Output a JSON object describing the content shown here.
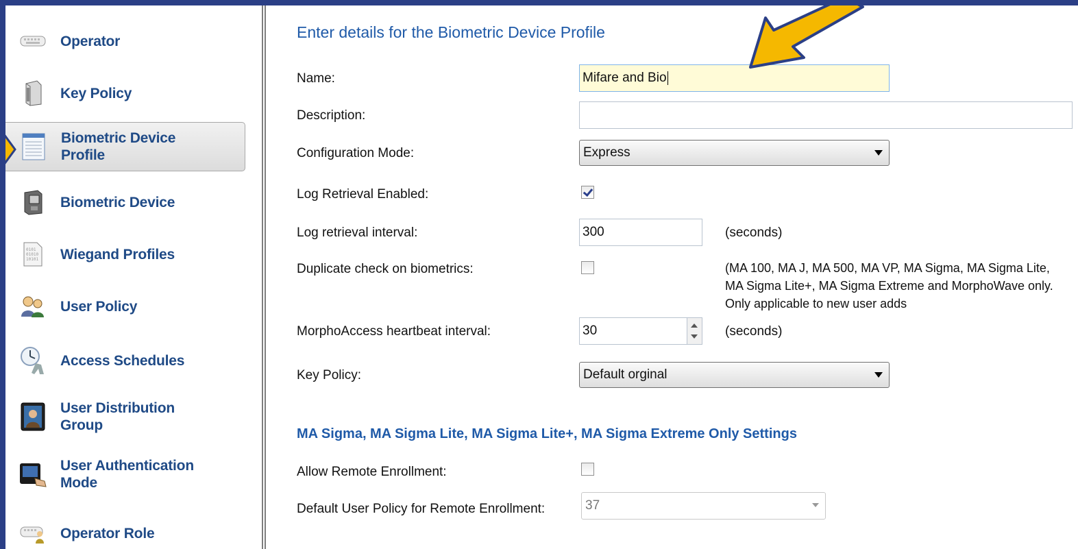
{
  "sidebar": {
    "items": [
      {
        "label": "Operator",
        "icon": "keyboard-icon"
      },
      {
        "label": "Key Policy",
        "icon": "server-icon"
      },
      {
        "label": "Biometric Device Profile",
        "icon": "document-list-icon"
      },
      {
        "label": "Biometric Device",
        "icon": "biometric-device-icon"
      },
      {
        "label": "Wiegand Profiles",
        "icon": "binary-document-icon"
      },
      {
        "label": "User Policy",
        "icon": "users-icon"
      },
      {
        "label": "Access Schedules",
        "icon": "clock-person-icon"
      },
      {
        "label": "User Distribution Group",
        "icon": "user-photo-icon"
      },
      {
        "label": "User Authentication Mode",
        "icon": "fingerprint-reader-icon"
      },
      {
        "label": "Operator Role",
        "icon": "keyboard-person-icon"
      }
    ],
    "selected_index": 2
  },
  "main": {
    "title": "Enter details for the Biometric Device Profile",
    "name": {
      "label": "Name:",
      "value": "Mifare and Bio"
    },
    "description": {
      "label": "Description:",
      "value": ""
    },
    "configuration_mode": {
      "label": "Configuration Mode:",
      "value": "Express"
    },
    "log_retrieval_enabled": {
      "label": "Log Retrieval Enabled:",
      "checked": true
    },
    "log_retrieval_interval": {
      "label": "Log retrieval interval:",
      "value": "300",
      "unit": "(seconds)"
    },
    "duplicate_check": {
      "label": "Duplicate check on biometrics:",
      "checked": false,
      "note": "(MA 100, MA J, MA 500, MA VP, MA Sigma, MA Sigma Lite, MA Sigma Lite+, MA Sigma Extreme and MorphoWave only.  Only applicable to new user adds"
    },
    "heartbeat_interval": {
      "label": "MorphoAccess heartbeat interval:",
      "value": "30",
      "unit": "(seconds)"
    },
    "key_policy": {
      "label": "Key Policy:",
      "value": "Default orginal"
    },
    "sigma_section_title": "MA Sigma, MA Sigma Lite, MA Sigma Lite+, MA Sigma Extreme Only Settings",
    "allow_remote_enrollment": {
      "label": "Allow Remote Enrollment:",
      "checked": false
    },
    "default_user_policy": {
      "label": "Default User Policy for Remote Enrollment:",
      "value": "37"
    }
  },
  "colors": {
    "background_border": "#2b3f86",
    "arrow": "#f5b800",
    "link_text": "#1f4a86",
    "title": "#1f5aa8",
    "active_field": "#fffbd7"
  }
}
